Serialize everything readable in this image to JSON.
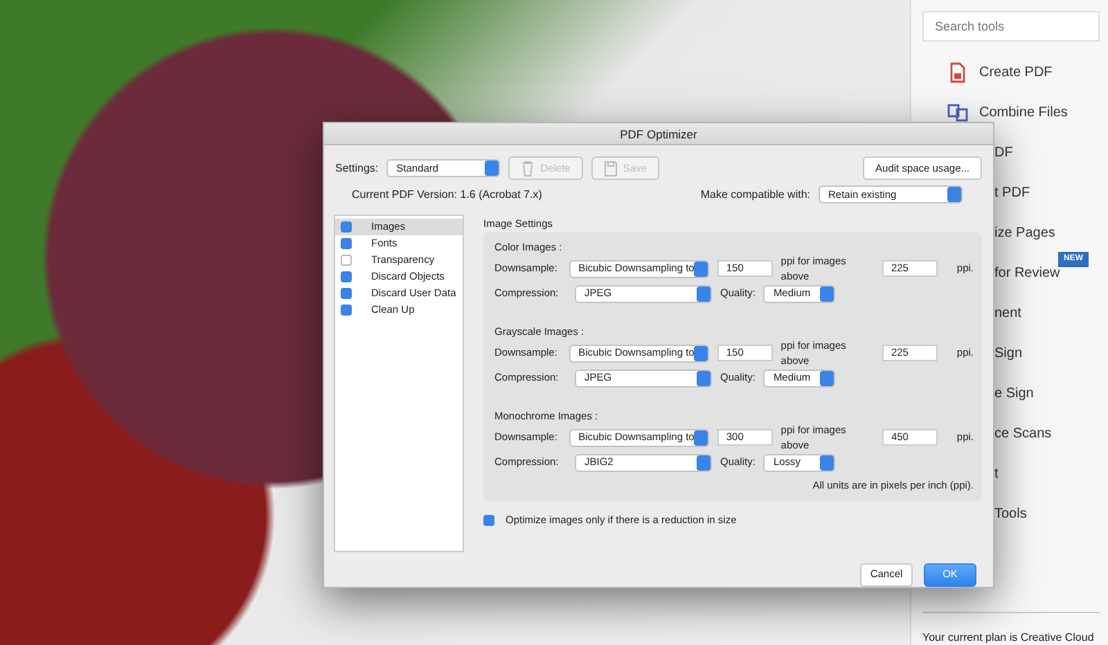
{
  "sidebar": {
    "search": {
      "placeholder": "Search tools"
    },
    "tools": [
      {
        "kind": "full",
        "label": "Create PDF"
      },
      {
        "kind": "full",
        "label": "Combine Files"
      },
      {
        "kind": "partial",
        "label": "DF"
      },
      {
        "kind": "partial",
        "label": "t PDF"
      },
      {
        "kind": "partial",
        "label": "ize Pages"
      },
      {
        "kind": "partial",
        "label": "for Review",
        "badge": "NEW"
      },
      {
        "kind": "partial",
        "label": "nent"
      },
      {
        "kind": "partial",
        "label": "Sign"
      },
      {
        "kind": "partial",
        "label": "e Sign"
      },
      {
        "kind": "partial",
        "label": "ce Scans"
      },
      {
        "kind": "partial",
        "label": "t"
      },
      {
        "kind": "partial",
        "label": "Tools"
      }
    ],
    "footer": "Your current plan is Creative Cloud"
  },
  "dialog": {
    "title": "PDF Optimizer",
    "settings_label": "Settings:",
    "settings_value": "Standard",
    "delete_button": {
      "label": "Delete",
      "disabled": true
    },
    "save_button": {
      "label": "Save",
      "disabled": true
    },
    "audit_button": "Audit space usage...",
    "version": "Current PDF Version: 1.6 (Acrobat 7.x)",
    "compatible_label": "Make compatible with:",
    "compatible_value": "Retain existing",
    "panels": [
      {
        "label": "Images",
        "checked": true,
        "selected": true
      },
      {
        "label": "Fonts",
        "checked": true,
        "selected": false
      },
      {
        "label": "Transparency",
        "checked": false,
        "selected": false
      },
      {
        "label": "Discard Objects",
        "checked": true,
        "selected": false
      },
      {
        "label": "Discard User Data",
        "checked": true,
        "selected": false
      },
      {
        "label": "Clean Up",
        "checked": true,
        "selected": false
      }
    ],
    "section_title": "Image Settings",
    "groups": [
      {
        "title": "Color Images :",
        "downsample_label": "Downsample:",
        "downsample_value": "Bicubic Downsampling to",
        "ppi": "150",
        "above_label": "ppi for images above",
        "above": "225",
        "unit": "ppi.",
        "compression_label": "Compression:",
        "compression_value": "JPEG",
        "quality_label": "Quality:",
        "quality_value": "Medium"
      },
      {
        "title": "Grayscale Images :",
        "downsample_label": "Downsample:",
        "downsample_value": "Bicubic Downsampling to",
        "ppi": "150",
        "above_label": "ppi for images above",
        "above": "225",
        "unit": "ppi.",
        "compression_label": "Compression:",
        "compression_value": "JPEG",
        "quality_label": "Quality:",
        "quality_value": "Medium"
      },
      {
        "title": "Monochrome Images :",
        "downsample_label": "Downsample:",
        "downsample_value": "Bicubic Downsampling to",
        "ppi": "300",
        "above_label": "ppi for images above",
        "above": "450",
        "unit": "ppi.",
        "compression_label": "Compression:",
        "compression_value": "JBIG2",
        "quality_label": "Quality:",
        "quality_value": "Lossy"
      }
    ],
    "units_note": "All units are in pixels per inch (ppi).",
    "optimize": {
      "label": "Optimize images only if there is a reduction in size",
      "checked": true
    },
    "cancel_button": "Cancel",
    "ok_button": "OK"
  }
}
